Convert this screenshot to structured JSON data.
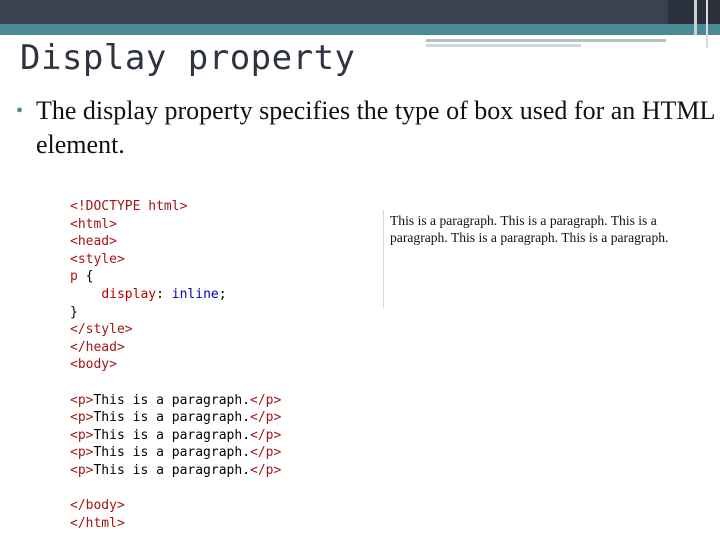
{
  "slide": {
    "title": "Display property",
    "bullet": "The display property specifies the type of box used for an HTML element.",
    "bullet_marker": "•"
  },
  "code_lines": [
    {
      "parts": [
        {
          "cls": "tag",
          "text": "<!DOCTYPE html>"
        }
      ]
    },
    {
      "parts": [
        {
          "cls": "tag",
          "text": "<html>"
        }
      ]
    },
    {
      "parts": [
        {
          "cls": "tag",
          "text": "<head>"
        }
      ]
    },
    {
      "parts": [
        {
          "cls": "tag",
          "text": "<style>"
        }
      ]
    },
    {
      "parts": [
        {
          "cls": "tag",
          "text": "p"
        },
        {
          "cls": "txt",
          "text": " {"
        }
      ]
    },
    {
      "parts": [
        {
          "cls": "txt",
          "text": "    "
        },
        {
          "cls": "prop",
          "text": "display"
        },
        {
          "cls": "txt",
          "text": ": "
        },
        {
          "cls": "val",
          "text": "inline"
        },
        {
          "cls": "txt",
          "text": ";"
        }
      ]
    },
    {
      "parts": [
        {
          "cls": "txt",
          "text": "}"
        }
      ]
    },
    {
      "parts": [
        {
          "cls": "tag",
          "text": "</style>"
        }
      ]
    },
    {
      "parts": [
        {
          "cls": "tag",
          "text": "</head>"
        }
      ]
    },
    {
      "parts": [
        {
          "cls": "tag",
          "text": "<body>"
        }
      ]
    },
    {
      "parts": []
    },
    {
      "parts": [
        {
          "cls": "tag",
          "text": "<p>"
        },
        {
          "cls": "txt",
          "text": "This is a paragraph."
        },
        {
          "cls": "tag",
          "text": "</p>"
        }
      ]
    },
    {
      "parts": [
        {
          "cls": "tag",
          "text": "<p>"
        },
        {
          "cls": "txt",
          "text": "This is a paragraph."
        },
        {
          "cls": "tag",
          "text": "</p>"
        }
      ]
    },
    {
      "parts": [
        {
          "cls": "tag",
          "text": "<p>"
        },
        {
          "cls": "txt",
          "text": "This is a paragraph."
        },
        {
          "cls": "tag",
          "text": "</p>"
        }
      ]
    },
    {
      "parts": [
        {
          "cls": "tag",
          "text": "<p>"
        },
        {
          "cls": "txt",
          "text": "This is a paragraph."
        },
        {
          "cls": "tag",
          "text": "</p>"
        }
      ]
    },
    {
      "parts": [
        {
          "cls": "tag",
          "text": "<p>"
        },
        {
          "cls": "txt",
          "text": "This is a paragraph."
        },
        {
          "cls": "tag",
          "text": "</p>"
        }
      ]
    },
    {
      "parts": []
    },
    {
      "parts": [
        {
          "cls": "tag",
          "text": "</body>"
        }
      ]
    },
    {
      "parts": [
        {
          "cls": "tag",
          "text": "</html>"
        }
      ]
    }
  ],
  "output": {
    "text": "This is a paragraph. This is a paragraph. This is a paragraph. This is a paragraph. This is a paragraph."
  }
}
